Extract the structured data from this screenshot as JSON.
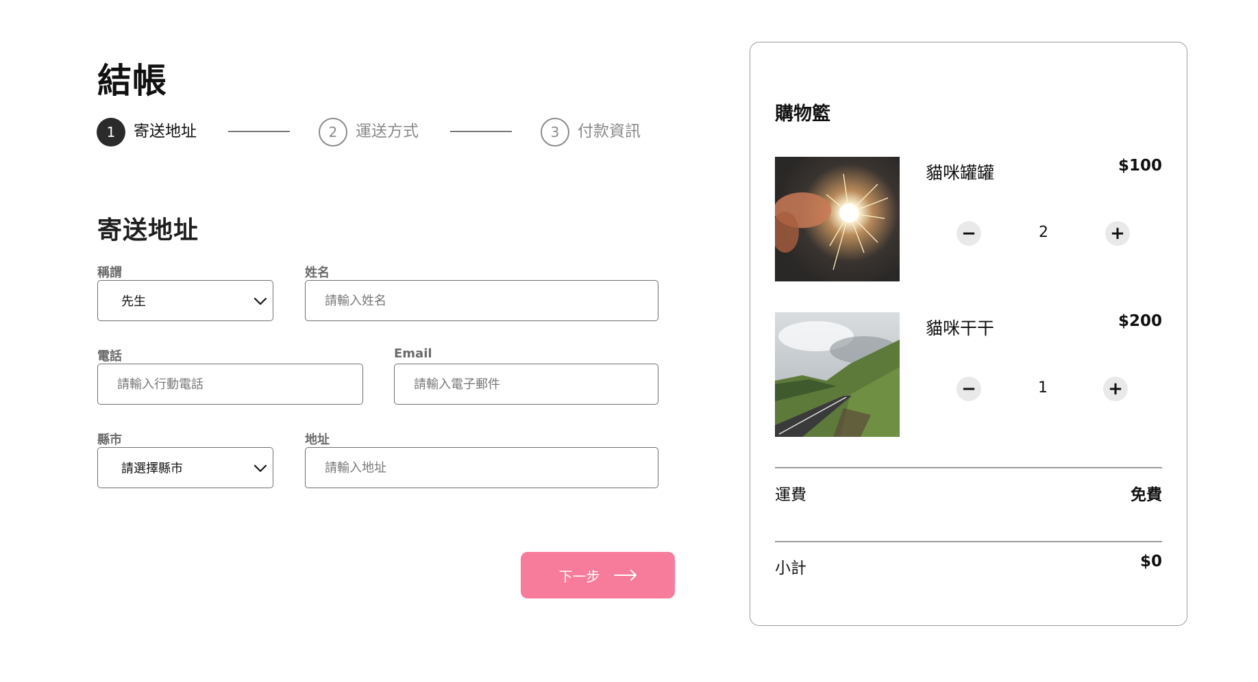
{
  "checkout": {
    "title": "結帳",
    "steps": [
      {
        "number": "1",
        "label": "寄送地址",
        "state": "active"
      },
      {
        "number": "2",
        "label": "運送方式",
        "state": "inactive"
      },
      {
        "number": "3",
        "label": "付款資訊",
        "state": "inactive"
      }
    ],
    "section_title": "寄送地址",
    "form": {
      "salutation": {
        "label": "稱謂",
        "value": "先生"
      },
      "name": {
        "label": "姓名",
        "placeholder": "請輸入姓名"
      },
      "phone": {
        "label": "電話",
        "placeholder": "請輸入行動電話"
      },
      "email": {
        "label": "Email",
        "placeholder": "請輸入電子郵件"
      },
      "city": {
        "label": "縣市",
        "value": "請選擇縣市"
      },
      "address": {
        "label": "地址",
        "placeholder": "請輸入地址"
      }
    },
    "next_button": {
      "label": "下一步",
      "icon": "arrow-right-icon"
    }
  },
  "cart": {
    "title": "購物籃",
    "items": [
      {
        "name": "貓咪罐罐",
        "price": "$100",
        "quantity": "2",
        "image": "sparkler-photo"
      },
      {
        "name": "貓咪干干",
        "price": "$200",
        "quantity": "1",
        "image": "mountain-road-photo"
      }
    ],
    "minus_symbol": "−",
    "plus_symbol": "+",
    "shipping": {
      "label": "運費",
      "value": "免費"
    },
    "subtotal": {
      "label": "小計",
      "value": "$0"
    }
  },
  "colors": {
    "accent": "#f77b9b",
    "step_active": "#2b2b2b",
    "step_inactive": "#8a8a8a",
    "border": "#6e6e6e"
  }
}
